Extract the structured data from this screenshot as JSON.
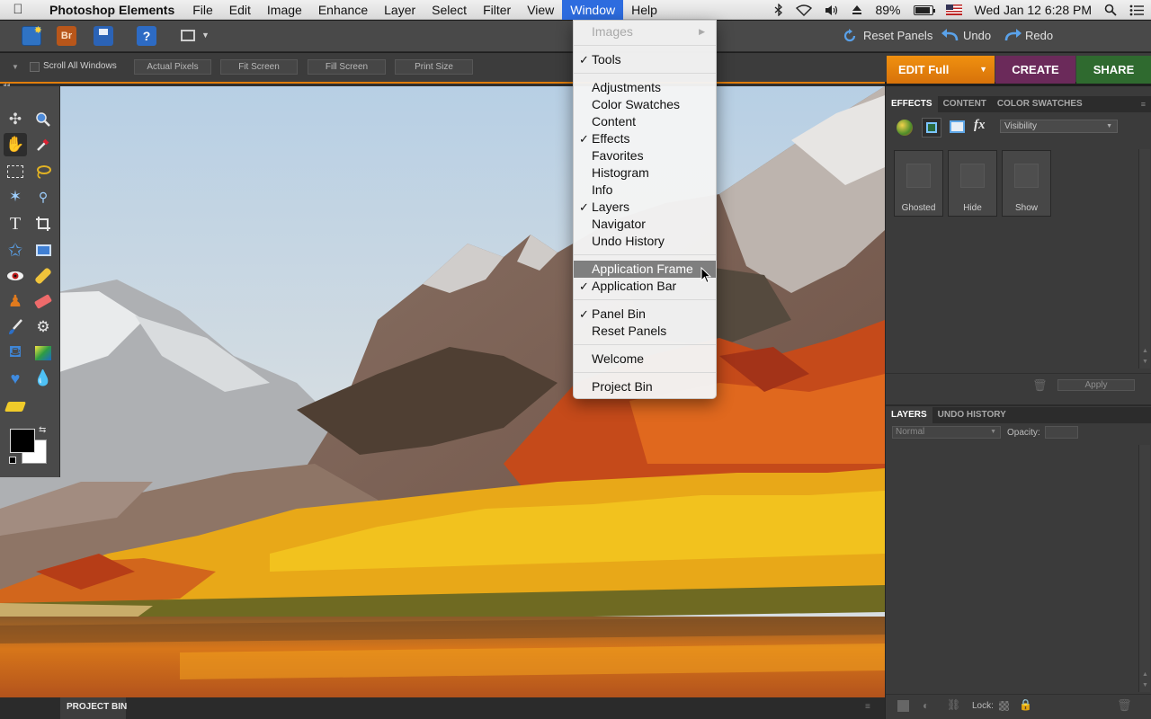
{
  "menubar": {
    "app_name": "Photoshop Elements",
    "menus": [
      "File",
      "Edit",
      "Image",
      "Enhance",
      "Layer",
      "Select",
      "Filter",
      "View",
      "Window",
      "Help"
    ],
    "active_menu": "Window",
    "status": {
      "battery": "89%",
      "datetime": "Wed Jan 12  6:28 PM"
    }
  },
  "appbar": {
    "reset_panels": "Reset Panels",
    "undo": "Undo",
    "redo": "Redo"
  },
  "options": {
    "scroll_all_windows": "Scroll All Windows",
    "actual_pixels": "Actual Pixels",
    "fit_screen": "Fit Screen",
    "fill_screen": "Fill Screen",
    "print_size": "Print Size"
  },
  "modes": {
    "edit": "EDIT Full",
    "create": "CREATE",
    "share": "SHARE"
  },
  "effects_panel": {
    "tabs": [
      "EFFECTS",
      "CONTENT",
      "COLOR SWATCHES"
    ],
    "filter_select": "Visibility",
    "thumbs": [
      "Ghosted",
      "Hide",
      "Show"
    ],
    "apply": "Apply"
  },
  "layers_panel": {
    "tabs": [
      "LAYERS",
      "UNDO HISTORY"
    ],
    "blend_mode": "Normal",
    "opacity_label": "Opacity:",
    "lock_label": "Lock:"
  },
  "project_bin": {
    "title": "PROJECT BIN"
  },
  "window_menu": {
    "images": "Images",
    "tools": "Tools",
    "adjustments": "Adjustments",
    "color_swatches": "Color Swatches",
    "content": "Content",
    "effects": "Effects",
    "favorites": "Favorites",
    "histogram": "Histogram",
    "info": "Info",
    "layers": "Layers",
    "navigator": "Navigator",
    "undo_history": "Undo History",
    "application_frame": "Application Frame",
    "application_bar": "Application Bar",
    "panel_bin": "Panel Bin",
    "reset_panels": "Reset Panels",
    "welcome": "Welcome",
    "project_bin": "Project Bin",
    "check": "✓"
  },
  "colors": {
    "accent_orange": "#e17e0c",
    "create_purple": "#6b2a5a",
    "share_green": "#2f6a2f",
    "menu_highlight": "#2d6cdf"
  }
}
